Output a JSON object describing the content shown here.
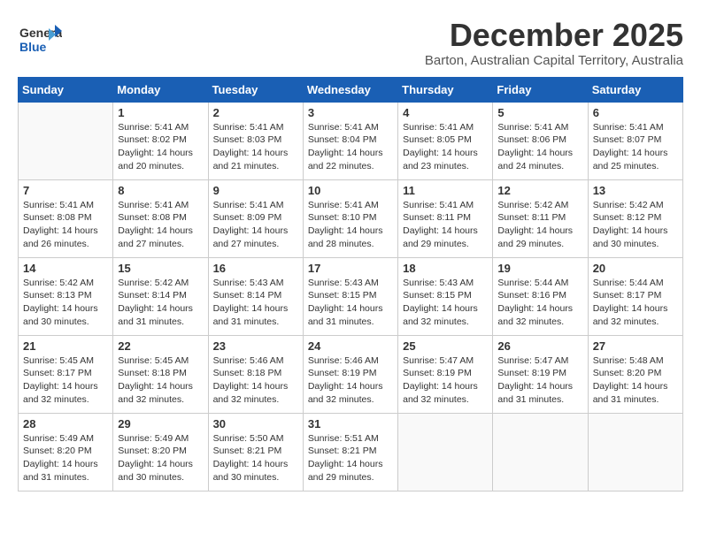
{
  "header": {
    "logo_line1": "General",
    "logo_line2": "Blue",
    "month": "December 2025",
    "location": "Barton, Australian Capital Territory, Australia"
  },
  "weekdays": [
    "Sunday",
    "Monday",
    "Tuesday",
    "Wednesday",
    "Thursday",
    "Friday",
    "Saturday"
  ],
  "weeks": [
    [
      {
        "day": "",
        "text": ""
      },
      {
        "day": "1",
        "text": "Sunrise: 5:41 AM\nSunset: 8:02 PM\nDaylight: 14 hours\nand 20 minutes."
      },
      {
        "day": "2",
        "text": "Sunrise: 5:41 AM\nSunset: 8:03 PM\nDaylight: 14 hours\nand 21 minutes."
      },
      {
        "day": "3",
        "text": "Sunrise: 5:41 AM\nSunset: 8:04 PM\nDaylight: 14 hours\nand 22 minutes."
      },
      {
        "day": "4",
        "text": "Sunrise: 5:41 AM\nSunset: 8:05 PM\nDaylight: 14 hours\nand 23 minutes."
      },
      {
        "day": "5",
        "text": "Sunrise: 5:41 AM\nSunset: 8:06 PM\nDaylight: 14 hours\nand 24 minutes."
      },
      {
        "day": "6",
        "text": "Sunrise: 5:41 AM\nSunset: 8:07 PM\nDaylight: 14 hours\nand 25 minutes."
      }
    ],
    [
      {
        "day": "7",
        "text": "Sunrise: 5:41 AM\nSunset: 8:08 PM\nDaylight: 14 hours\nand 26 minutes."
      },
      {
        "day": "8",
        "text": "Sunrise: 5:41 AM\nSunset: 8:08 PM\nDaylight: 14 hours\nand 27 minutes."
      },
      {
        "day": "9",
        "text": "Sunrise: 5:41 AM\nSunset: 8:09 PM\nDaylight: 14 hours\nand 27 minutes."
      },
      {
        "day": "10",
        "text": "Sunrise: 5:41 AM\nSunset: 8:10 PM\nDaylight: 14 hours\nand 28 minutes."
      },
      {
        "day": "11",
        "text": "Sunrise: 5:41 AM\nSunset: 8:11 PM\nDaylight: 14 hours\nand 29 minutes."
      },
      {
        "day": "12",
        "text": "Sunrise: 5:42 AM\nSunset: 8:11 PM\nDaylight: 14 hours\nand 29 minutes."
      },
      {
        "day": "13",
        "text": "Sunrise: 5:42 AM\nSunset: 8:12 PM\nDaylight: 14 hours\nand 30 minutes."
      }
    ],
    [
      {
        "day": "14",
        "text": "Sunrise: 5:42 AM\nSunset: 8:13 PM\nDaylight: 14 hours\nand 30 minutes."
      },
      {
        "day": "15",
        "text": "Sunrise: 5:42 AM\nSunset: 8:14 PM\nDaylight: 14 hours\nand 31 minutes."
      },
      {
        "day": "16",
        "text": "Sunrise: 5:43 AM\nSunset: 8:14 PM\nDaylight: 14 hours\nand 31 minutes."
      },
      {
        "day": "17",
        "text": "Sunrise: 5:43 AM\nSunset: 8:15 PM\nDaylight: 14 hours\nand 31 minutes."
      },
      {
        "day": "18",
        "text": "Sunrise: 5:43 AM\nSunset: 8:15 PM\nDaylight: 14 hours\nand 32 minutes."
      },
      {
        "day": "19",
        "text": "Sunrise: 5:44 AM\nSunset: 8:16 PM\nDaylight: 14 hours\nand 32 minutes."
      },
      {
        "day": "20",
        "text": "Sunrise: 5:44 AM\nSunset: 8:17 PM\nDaylight: 14 hours\nand 32 minutes."
      }
    ],
    [
      {
        "day": "21",
        "text": "Sunrise: 5:45 AM\nSunset: 8:17 PM\nDaylight: 14 hours\nand 32 minutes."
      },
      {
        "day": "22",
        "text": "Sunrise: 5:45 AM\nSunset: 8:18 PM\nDaylight: 14 hours\nand 32 minutes."
      },
      {
        "day": "23",
        "text": "Sunrise: 5:46 AM\nSunset: 8:18 PM\nDaylight: 14 hours\nand 32 minutes."
      },
      {
        "day": "24",
        "text": "Sunrise: 5:46 AM\nSunset: 8:19 PM\nDaylight: 14 hours\nand 32 minutes."
      },
      {
        "day": "25",
        "text": "Sunrise: 5:47 AM\nSunset: 8:19 PM\nDaylight: 14 hours\nand 32 minutes."
      },
      {
        "day": "26",
        "text": "Sunrise: 5:47 AM\nSunset: 8:19 PM\nDaylight: 14 hours\nand 31 minutes."
      },
      {
        "day": "27",
        "text": "Sunrise: 5:48 AM\nSunset: 8:20 PM\nDaylight: 14 hours\nand 31 minutes."
      }
    ],
    [
      {
        "day": "28",
        "text": "Sunrise: 5:49 AM\nSunset: 8:20 PM\nDaylight: 14 hours\nand 31 minutes."
      },
      {
        "day": "29",
        "text": "Sunrise: 5:49 AM\nSunset: 8:20 PM\nDaylight: 14 hours\nand 30 minutes."
      },
      {
        "day": "30",
        "text": "Sunrise: 5:50 AM\nSunset: 8:21 PM\nDaylight: 14 hours\nand 30 minutes."
      },
      {
        "day": "31",
        "text": "Sunrise: 5:51 AM\nSunset: 8:21 PM\nDaylight: 14 hours\nand 29 minutes."
      },
      {
        "day": "",
        "text": ""
      },
      {
        "day": "",
        "text": ""
      },
      {
        "day": "",
        "text": ""
      }
    ]
  ]
}
